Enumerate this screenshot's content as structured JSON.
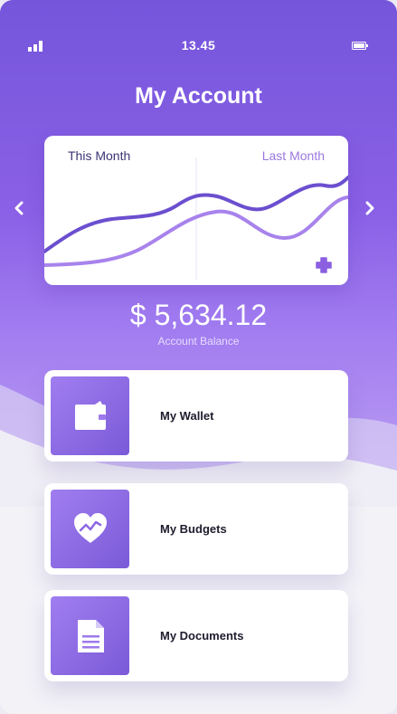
{
  "status_bar": {
    "time": "13.45",
    "signal_icon": "signal-icon",
    "battery_icon": "battery-icon"
  },
  "header": {
    "title": "My Account"
  },
  "chart": {
    "legend": {
      "this_month": "This Month",
      "last_month": "Last Month"
    },
    "colors": {
      "this_month": "#6b4fcf",
      "last_month": "#a883ec"
    },
    "add_icon": "plus-icon",
    "prev_icon": "chevron-left-icon",
    "next_icon": "chevron-right-icon"
  },
  "balance": {
    "amount": "$ 5,634.12",
    "label": "Account Balance"
  },
  "menu": [
    {
      "label": "My Wallet",
      "icon": "wallet-icon"
    },
    {
      "label": "My Budgets",
      "icon": "heart-trend-icon"
    },
    {
      "label": "My Documents",
      "icon": "document-icon"
    }
  ],
  "theme": {
    "primary": "#7556db",
    "accent": "#a883ec",
    "background": "#f3f2f7"
  }
}
